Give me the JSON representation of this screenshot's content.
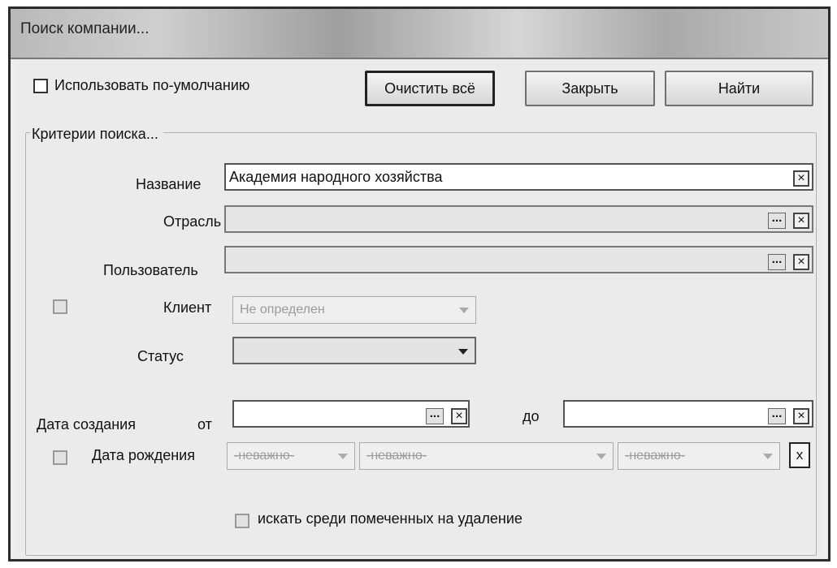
{
  "window": {
    "title": "Поиск компании..."
  },
  "top": {
    "use_default_label": "Использовать по-умолчанию",
    "clear_all_label": "Очистить всё",
    "close_label": "Закрыть",
    "find_label": "Найти"
  },
  "criteria": {
    "group_title": "Критерии поиска...",
    "name_label": "Название",
    "name_value": "Академия народного хозяйства",
    "industry_label": "Отрасль",
    "industry_value": "",
    "user_label": "Пользователь",
    "user_value": "",
    "client_label": "Клиент",
    "client_value": "Не определен",
    "status_label": "Статус",
    "status_value": "",
    "created_label": "Дата создания",
    "from_label": "от",
    "from_value": "",
    "to_label": "до",
    "to_value": "",
    "birth_label": "Дата рождения",
    "birth_day": "-неважно-",
    "birth_month": "-неважно-",
    "birth_year": "-неважно-",
    "clear_x": "x",
    "deleted_label": "искать среди помеченных на удаление"
  },
  "icons": {
    "clear": "x-icon",
    "ellipsis": "ellipsis-icon"
  }
}
